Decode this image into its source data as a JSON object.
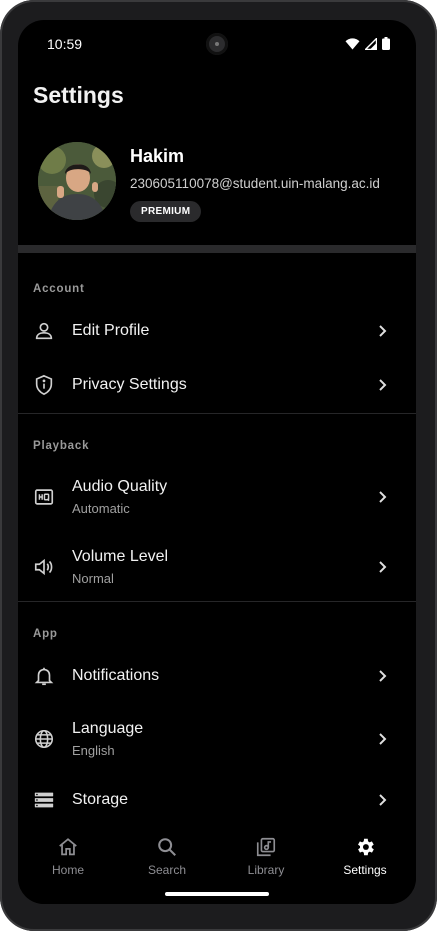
{
  "status_bar": {
    "time": "10:59"
  },
  "page": {
    "title": "Settings"
  },
  "profile": {
    "name": "Hakim",
    "email": "230605110078@student.uin-malang.ac.id",
    "badge": "PREMIUM"
  },
  "sections": {
    "account": {
      "header": "Account",
      "edit_profile": {
        "title": "Edit Profile",
        "icon": "person-icon"
      },
      "privacy_settings": {
        "title": "Privacy Settings",
        "icon": "shield-icon"
      }
    },
    "playback": {
      "header": "Playback",
      "audio_quality": {
        "title": "Audio Quality",
        "value": "Automatic",
        "icon": "hq-icon"
      },
      "volume_level": {
        "title": "Volume Level",
        "value": "Normal",
        "icon": "volume-icon"
      }
    },
    "app": {
      "header": "App",
      "notifications": {
        "title": "Notifications",
        "icon": "bell-icon"
      },
      "language": {
        "title": "Language",
        "value": "English",
        "icon": "globe-icon"
      },
      "storage": {
        "title": "Storage",
        "icon": "storage-icon"
      }
    }
  },
  "bottom_nav": {
    "items": [
      {
        "label": "Home",
        "icon": "home-icon"
      },
      {
        "label": "Search",
        "icon": "search-icon"
      },
      {
        "label": "Library",
        "icon": "library-icon"
      },
      {
        "label": "Settings",
        "icon": "gear-icon"
      }
    ],
    "active": "Settings"
  },
  "colors": {
    "background": "#000000",
    "divider": "#2a2a2c",
    "text_primary": "#f2f2f2",
    "text_secondary": "#a0a0a0"
  }
}
